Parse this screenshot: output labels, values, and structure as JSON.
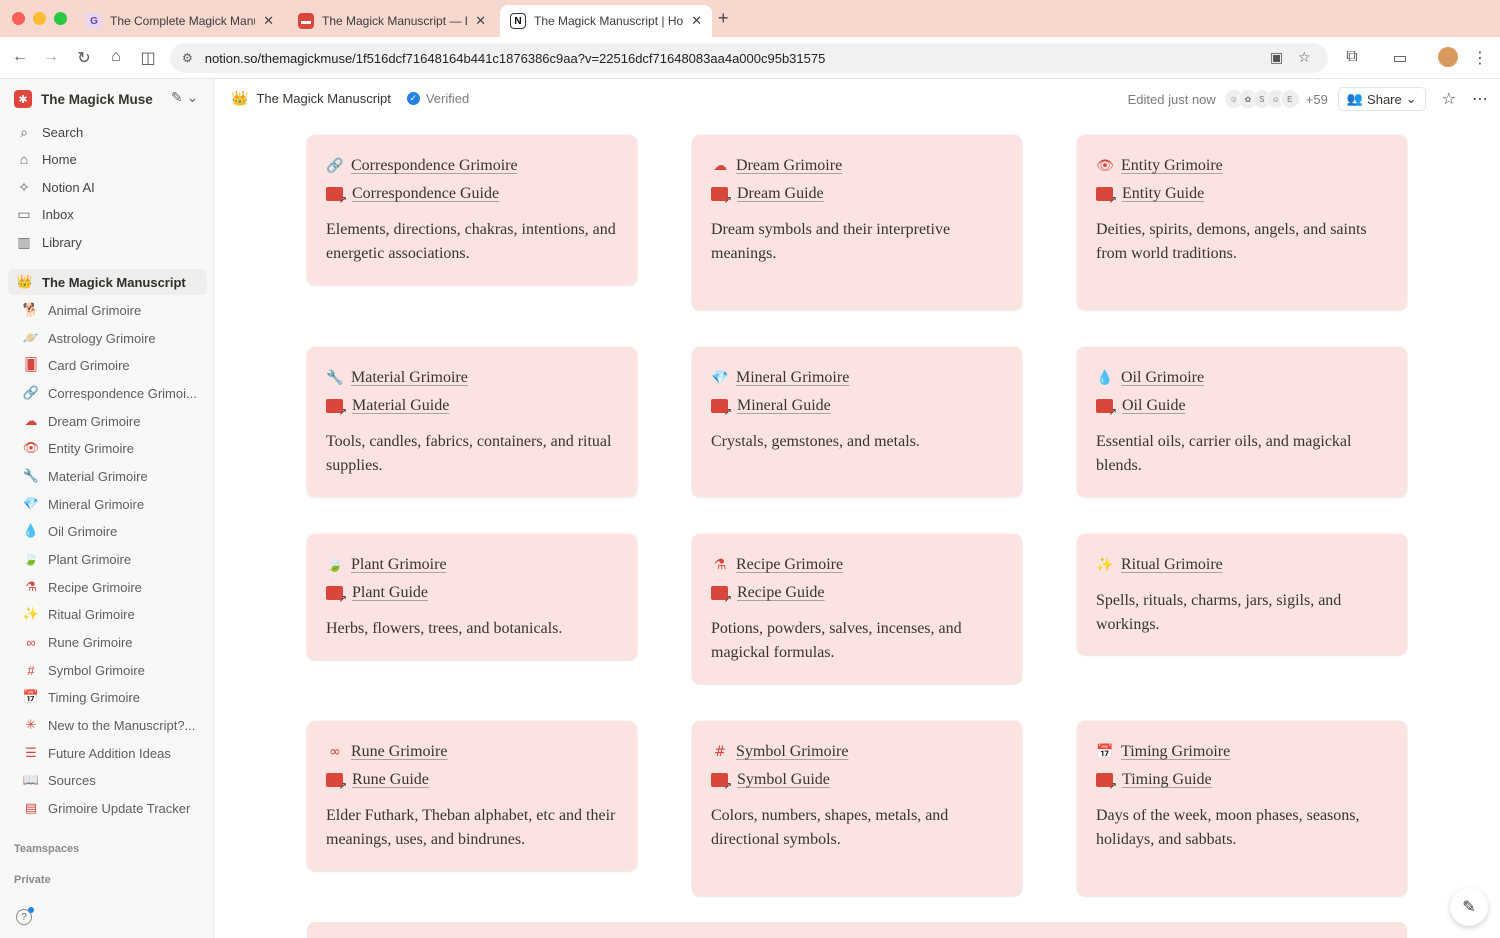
{
  "browser": {
    "tabs": [
      {
        "title": "The Complete Magick Manuscript",
        "favicon": "G"
      },
      {
        "title": "The Magick Manuscript — Life",
        "favicon": "book-icon"
      },
      {
        "title": "The Magick Manuscript | Home",
        "favicon": "N"
      }
    ],
    "new_tab": "+",
    "url": "notion.so/themagickmuse/1f516dcf71648164b441c1876386c9aa?v=22516dcf71648083aa4a000c95b31575"
  },
  "sidebar": {
    "workspace": "The Magick Muse",
    "nav": [
      {
        "label": "Search",
        "icon": "search-icon"
      },
      {
        "label": "Home",
        "icon": "home-icon"
      },
      {
        "label": "Notion AI",
        "icon": "ai-icon"
      },
      {
        "label": "Inbox",
        "icon": "inbox-icon"
      },
      {
        "label": "Library",
        "icon": "library-icon"
      }
    ],
    "current_page": "The Magick Manuscript",
    "items": [
      {
        "label": "Animal Grimoire",
        "icon": "🐕"
      },
      {
        "label": "Astrology Grimoire",
        "icon": "🪐"
      },
      {
        "label": "Card Grimoire",
        "icon": "🂠"
      },
      {
        "label": "Correspondence Grimoi...",
        "icon": "🔗"
      },
      {
        "label": "Dream Grimoire",
        "icon": "☁"
      },
      {
        "label": "Entity Grimoire",
        "icon": "👁"
      },
      {
        "label": "Material Grimoire",
        "icon": "🔧"
      },
      {
        "label": "Mineral Grimoire",
        "icon": "💎"
      },
      {
        "label": "Oil Grimoire",
        "icon": "💧"
      },
      {
        "label": "Plant Grimoire",
        "icon": "🍃"
      },
      {
        "label": "Recipe Grimoire",
        "icon": "⚗"
      },
      {
        "label": "Ritual Grimoire",
        "icon": "✨"
      },
      {
        "label": "Rune Grimoire",
        "icon": "∞"
      },
      {
        "label": "Symbol Grimoire",
        "icon": "#"
      },
      {
        "label": "Timing Grimoire",
        "icon": "📅"
      },
      {
        "label": "New to the Manuscript?...",
        "icon": "✳"
      },
      {
        "label": "Future Addition Ideas",
        "icon": "☰"
      },
      {
        "label": "Sources",
        "icon": "📖"
      },
      {
        "label": "Grimoire Update Tracker",
        "icon": "▤"
      }
    ],
    "sections": [
      "Teamspaces",
      "Private"
    ]
  },
  "topbar": {
    "page_title": "The Magick Manuscript",
    "verified": "Verified",
    "edited": "Edited just now",
    "avatar_letters": [
      "S",
      "E"
    ],
    "extra_count": "+59",
    "share": "Share"
  },
  "cards": [
    {
      "title": "Correspondence Grimoire",
      "icon": "🔗",
      "guide": "Correspondence Guide",
      "desc": "Elements, directions, chakras, intentions, and energetic associations."
    },
    {
      "title": "Dream Grimoire",
      "icon": "☁",
      "guide": "Dream Guide",
      "desc": "Dream symbols and their interpretive meanings."
    },
    {
      "title": "Entity Grimoire",
      "icon": "👁",
      "guide": "Entity Guide",
      "desc": "Deities, spirits, demons, angels, and saints from world traditions."
    },
    {
      "title": "Material Grimoire",
      "icon": "🔧",
      "guide": "Material Guide",
      "desc": "Tools, candles, fabrics, containers, and ritual supplies."
    },
    {
      "title": "Mineral Grimoire",
      "icon": "💎",
      "guide": "Mineral Guide",
      "desc": "Crystals, gemstones, and metals."
    },
    {
      "title": "Oil Grimoire",
      "icon": "💧",
      "guide": "Oil Guide",
      "desc": "Essential oils, carrier oils, and magickal blends."
    },
    {
      "title": "Plant Grimoire",
      "icon": "🍃",
      "guide": "Plant Guide",
      "desc": "Herbs, flowers, trees, and botanicals."
    },
    {
      "title": "Recipe Grimoire",
      "icon": "⚗",
      "guide": "Recipe Guide",
      "desc": "Potions, powders, salves, incenses, and magickal formulas."
    },
    {
      "title": "Ritual Grimoire",
      "icon": "✨",
      "guide": "",
      "desc": "Spells, rituals, charms, jars, sigils, and workings."
    },
    {
      "title": "Rune Grimoire",
      "icon": "∞",
      "guide": "Rune Guide",
      "desc": "Elder Futhark, Theban alphabet, etc and their meanings, uses, and bindrunes."
    },
    {
      "title": "Symbol Grimoire",
      "icon": "#",
      "guide": "Symbol Guide",
      "desc": "Colors, numbers, shapes, metals, and directional symbols."
    },
    {
      "title": "Timing Grimoire",
      "icon": "📅",
      "guide": "Timing Guide",
      "desc": "Days of the week, moon phases, seasons, holidays, and sabbats."
    }
  ],
  "colors": {
    "accent": "#d9473c",
    "card_bg": "#fbe3e1",
    "tabbar_bg": "#f7d8cf"
  }
}
